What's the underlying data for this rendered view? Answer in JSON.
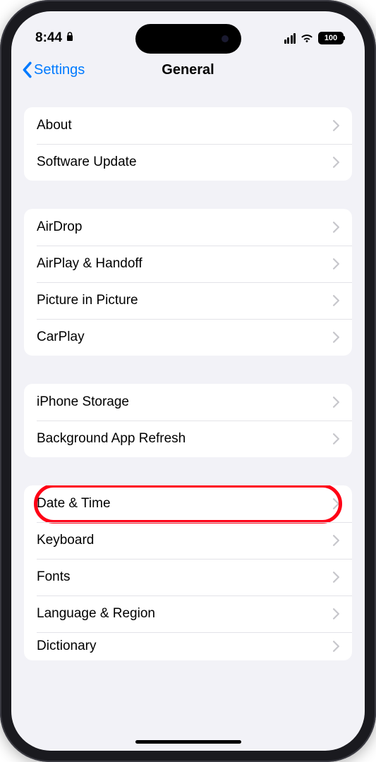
{
  "status": {
    "time": "8:44",
    "battery": "100"
  },
  "nav": {
    "back": "Settings",
    "title": "General"
  },
  "groups": [
    {
      "rows": [
        {
          "label": "About"
        },
        {
          "label": "Software Update"
        }
      ]
    },
    {
      "rows": [
        {
          "label": "AirDrop"
        },
        {
          "label": "AirPlay & Handoff"
        },
        {
          "label": "Picture in Picture"
        },
        {
          "label": "CarPlay"
        }
      ]
    },
    {
      "rows": [
        {
          "label": "iPhone Storage"
        },
        {
          "label": "Background App Refresh"
        }
      ]
    },
    {
      "rows": [
        {
          "label": "Date & Time",
          "highlighted": true
        },
        {
          "label": "Keyboard"
        },
        {
          "label": "Fonts"
        },
        {
          "label": "Language & Region"
        },
        {
          "label": "Dictionary"
        }
      ]
    }
  ]
}
